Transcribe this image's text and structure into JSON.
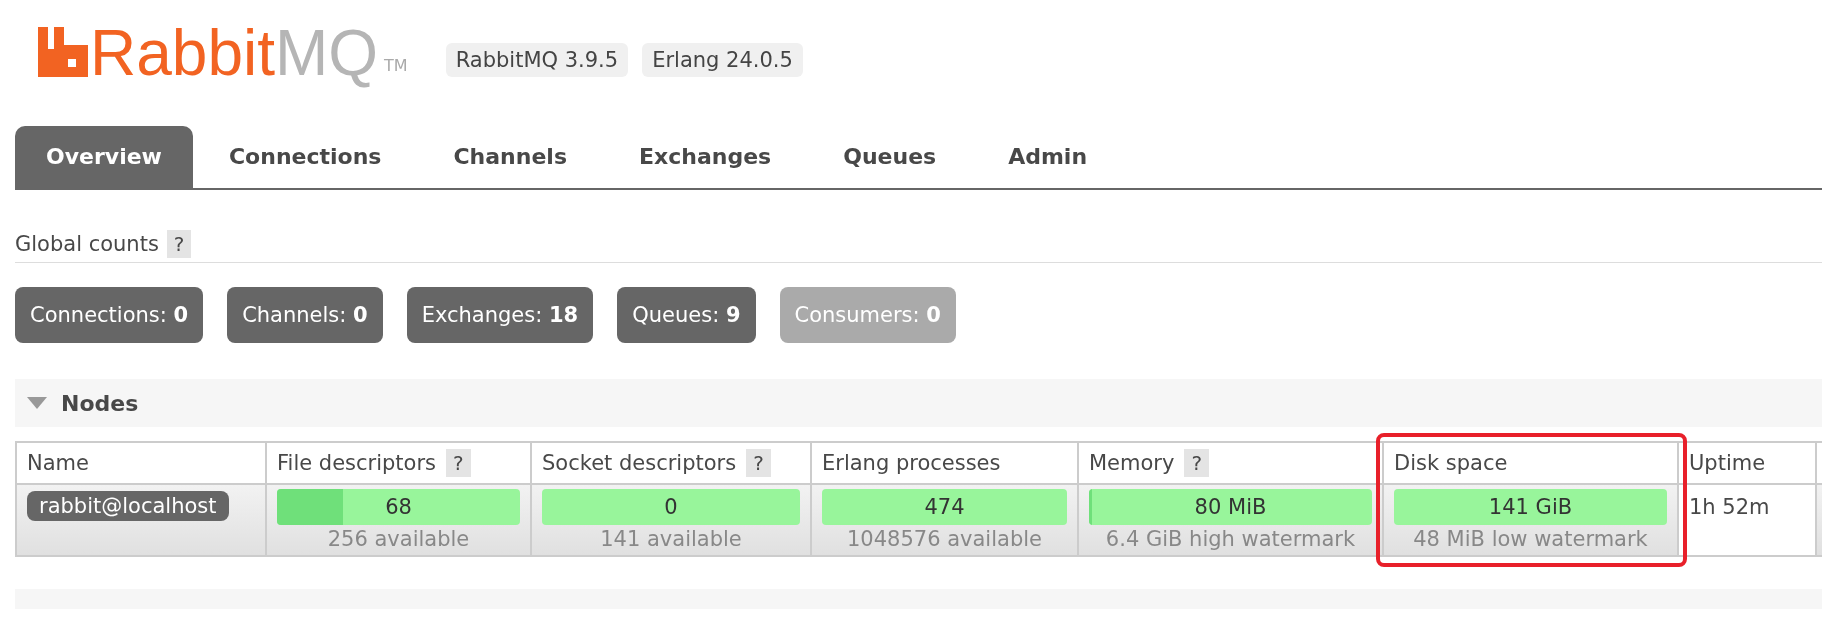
{
  "logo": {
    "brand": "Rabbit",
    "suffix": "MQ",
    "mark": "TM"
  },
  "versions": [
    "RabbitMQ 3.9.5",
    "Erlang 24.0.5"
  ],
  "tabs": [
    {
      "label": "Overview",
      "selected": true
    },
    {
      "label": "Connections",
      "selected": false
    },
    {
      "label": "Channels",
      "selected": false
    },
    {
      "label": "Exchanges",
      "selected": false
    },
    {
      "label": "Queues",
      "selected": false
    },
    {
      "label": "Admin",
      "selected": false
    }
  ],
  "global_counts": {
    "title": "Global counts",
    "help": "?",
    "items": [
      {
        "label": "Connections:",
        "value": "0",
        "disabled": false
      },
      {
        "label": "Channels:",
        "value": "0",
        "disabled": false
      },
      {
        "label": "Exchanges:",
        "value": "18",
        "disabled": false
      },
      {
        "label": "Queues:",
        "value": "9",
        "disabled": false
      },
      {
        "label": "Consumers:",
        "value": "0",
        "disabled": true
      }
    ]
  },
  "nodes": {
    "title": "Nodes",
    "expanded": true,
    "columns": [
      {
        "label": "Name",
        "highlighted": false
      },
      {
        "label": "File descriptors",
        "help": "?",
        "highlighted": false
      },
      {
        "label": "Socket descriptors",
        "help": "?",
        "highlighted": false
      },
      {
        "label": "Erlang processes",
        "highlighted": false
      },
      {
        "label": "Memory",
        "help": "?",
        "highlighted": false
      },
      {
        "label": "Disk space",
        "highlighted": true
      },
      {
        "label": "Uptime",
        "highlighted": false
      }
    ],
    "rows": [
      {
        "name": "rabbit@localhost",
        "meters": [
          {
            "reading": "68",
            "level": 0.27,
            "note": "256 available"
          },
          {
            "reading": "0",
            "note": "141 available"
          },
          {
            "reading": "474",
            "note": "1048576 available"
          },
          {
            "reading": "80 MiB",
            "level": 0.012,
            "note": "6.4 GiB high watermark"
          },
          {
            "reading": "141 GiB",
            "note": "48 MiB low watermark"
          }
        ],
        "uptime": "1h 52m"
      }
    ]
  }
}
